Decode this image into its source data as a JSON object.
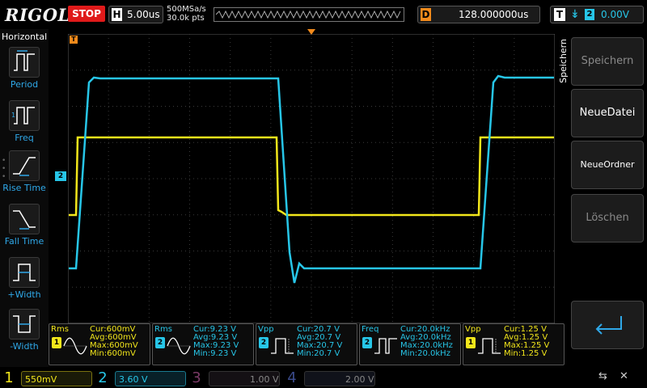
{
  "topbar": {
    "logo": "RIGOL",
    "run_state": "STOP",
    "timebase": {
      "letter": "H",
      "value": "5.00us"
    },
    "sample_rate": "500MSa/s",
    "memory_depth": "30.0k pts",
    "delay": {
      "letter": "D",
      "value": "128.000000us"
    },
    "trigger": {
      "letter": "T",
      "edge": "↡",
      "source": "2",
      "level": "0.00V"
    }
  },
  "leftbar": {
    "title": "Horizontal",
    "items": [
      {
        "label": "Period",
        "icon": "period-icon"
      },
      {
        "label": "Freq",
        "icon": "freq-icon"
      },
      {
        "label": "Rise Time",
        "icon": "rise-time-icon"
      },
      {
        "label": "Fall Time",
        "icon": "fall-time-icon"
      },
      {
        "label": "+Width",
        "icon": "positive-width-icon"
      },
      {
        "label": "-Width",
        "icon": "negative-width-icon"
      }
    ]
  },
  "rightmenu": {
    "title": "Speichern",
    "buttons": [
      {
        "label": "Speichern",
        "enabled": false
      },
      {
        "label": "NeueDatei",
        "enabled": true
      },
      {
        "label": "NeueOrdner",
        "enabled": true
      },
      {
        "label": "Löschen",
        "enabled": false
      }
    ],
    "back_icon": "return-arrow-icon"
  },
  "markers": {
    "ch1_marker": "1",
    "ch2_marker": "2",
    "trigger_pos_marker": "T",
    "trigger_level_marker": "T"
  },
  "measurements": [
    {
      "name": "Rms",
      "channel": "1",
      "color": "#f2e61b",
      "cur": "Cur:600mV",
      "avg": "Avg:600mV",
      "max": "Max:600mV",
      "min": "Min:600mV"
    },
    {
      "name": "Rms",
      "channel": "2",
      "color": "#27c6e8",
      "cur": "Cur:9.23 V",
      "avg": "Avg:9.23 V",
      "max": "Max:9.23 V",
      "min": "Min:9.23 V"
    },
    {
      "name": "Vpp",
      "channel": "2",
      "color": "#27c6e8",
      "cur": "Cur:20.7 V",
      "avg": "Avg:20.7 V",
      "max": "Max:20.7 V",
      "min": "Min:20.7 V"
    },
    {
      "name": "Freq",
      "channel": "2",
      "color": "#27c6e8",
      "cur": "Cur:20.0kHz",
      "avg": "Avg:20.0kHz",
      "max": "Max:20.0kHz",
      "min": "Min:20.0kHz"
    },
    {
      "name": "Vpp",
      "channel": "1",
      "color": "#f2e61b",
      "cur": "Cur:1.25 V",
      "avg": "Avg:1.25 V",
      "max": "Max:1.25 V",
      "min": "Min:1.25 V"
    }
  ],
  "channels": [
    {
      "num": "1",
      "scale": "550mV",
      "color": "#f2e61b",
      "active": true
    },
    {
      "num": "2",
      "scale": "3.60 V",
      "color": "#27c6e8",
      "active": true
    },
    {
      "num": "3",
      "scale": "1.00 V",
      "color": "#c0409a",
      "active": false
    },
    {
      "num": "4",
      "scale": "2.00 V",
      "color": "#4a6ad8",
      "active": false
    }
  ],
  "status_icons": [
    "usb-icon",
    "mute-icon"
  ],
  "colors": {
    "ch1": "#f2e61b",
    "ch2": "#27c6e8",
    "stop": "#e01a1a",
    "accent": "#2fa8e8"
  }
}
